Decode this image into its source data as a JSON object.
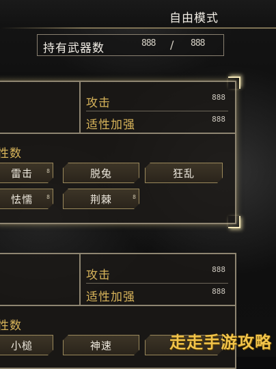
{
  "header": {
    "mode_label": "自由模式"
  },
  "weapon_count": {
    "label": "持有武器数",
    "current": "888",
    "total": "888"
  },
  "cards": [
    {
      "attack_label": "攻击",
      "attack_value": "888",
      "aptitude_label": "适性加强",
      "aptitude_value": "888",
      "traits_label": "性数",
      "skills": [
        {
          "name": "雷击",
          "lv": "8"
        },
        {
          "name": "脱兔",
          "lv": ""
        },
        {
          "name": "狂乱",
          "lv": ""
        },
        {
          "name": "怯懦",
          "lv": "8"
        },
        {
          "name": "荆棘",
          "lv": "8"
        }
      ]
    },
    {
      "attack_label": "攻击",
      "attack_value": "888",
      "aptitude_label": "适性加强",
      "aptitude_value": "888",
      "traits_label": "性数",
      "skills": [
        {
          "name": "小槌",
          "lv": ""
        },
        {
          "name": "神速",
          "lv": ""
        },
        {
          "name": "",
          "lv": ""
        }
      ]
    }
  ],
  "watermark": "走走手游攻略",
  "colors": {
    "gold_text": "#d8b45a",
    "frame": "#8f8672",
    "glow": "#f4e7b8"
  }
}
